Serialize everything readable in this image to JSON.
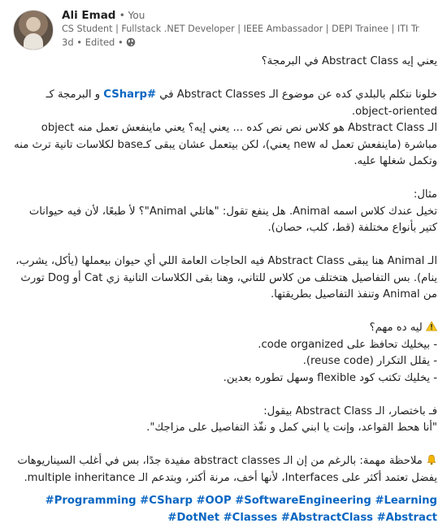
{
  "author": {
    "name": "Ali Emad",
    "degree": "• You",
    "headline": "CS Student | Fullstack .NET Developer | IEEE Ambassador | DEPI Trainee | ITI Tr...",
    "time": "3d • Edited •"
  },
  "icons": {
    "avatar": "avatar-photo",
    "visibility": "globe-icon",
    "warning": "warning-icon",
    "note": "bell-icon"
  },
  "colors": {
    "link": "#0a66c2",
    "text": "#1f1f1f",
    "muted": "#666666"
  },
  "post": {
    "title": "يعني إيه Abstract Class في البرمجة؟",
    "p1_before": "خلونا نتكلم بالبلدي كده عن موضوع الـ Abstract Classes في ",
    "p1_link": "#CSharp",
    "p1_after": " و البرمجة كـ object-oriented.",
    "p2": "الـ Abstract Class هو كلاس نص نص كده ... يعني إيه؟ يعني ماينفعش تعمل منه object مباشرة (ماينفعش تعمل له new يعني)، لكن بيتعمل عشان يبقى كـbase لكلاسات تانية ترث منه وتكمل شغلها عليه.",
    "example_label": "مثال:",
    "example_text": "تخيل عندك كلاس اسمه Animal. هل ينفع تقول: \"هاتلي Animal\"؟ لأ طبعًا، لأن فيه حيوانات كتير بأنواع مختلفة (قط، كلب، حصان).",
    "p3": "الـ Animal هنا يبقى Abstract Class فيه الحاجات العامة اللي أي حيوان بيعملها (يأكل، يشرب، ينام). بس التفاصيل هتختلف من كلاس للتاني، وهنا بقى الكلاسات التانية زي Cat أو Dog تورث من Animal وتنفذ التفاصيل بطريقتها.",
    "why_title": "ليه ده مهم؟",
    "why_items": [
      "- بيخليك تحافظ على code organized.",
      "- يقلل التكرار (reuse code).",
      "- يخليك تكتب كود flexible وسهل تطوره بعدين."
    ],
    "summary_line1": "فـ باختصار، الـ Abstract Class بيقول:",
    "summary_line2": "\"أنا هحط القواعد، وإنت يا ابني كمل و نفّذ التفاصيل على مزاجك\".",
    "note": "ملاحظة مهمة: بالرغم من إن الـ abstract classes مفيدة جدًا، بس في أغلب السيناريوهات يفضل تعتمد أكثر على Interfaces، لأنها أخف، مرنة أكتر، وبتدعم الـ multiple inheritance.",
    "tags_line1": "Programming #CSharp #OOP #SoftwareEngineering #Learning#",
    "tags_line2": "DotNet #Classes #AbstractClass #Abstract#"
  }
}
